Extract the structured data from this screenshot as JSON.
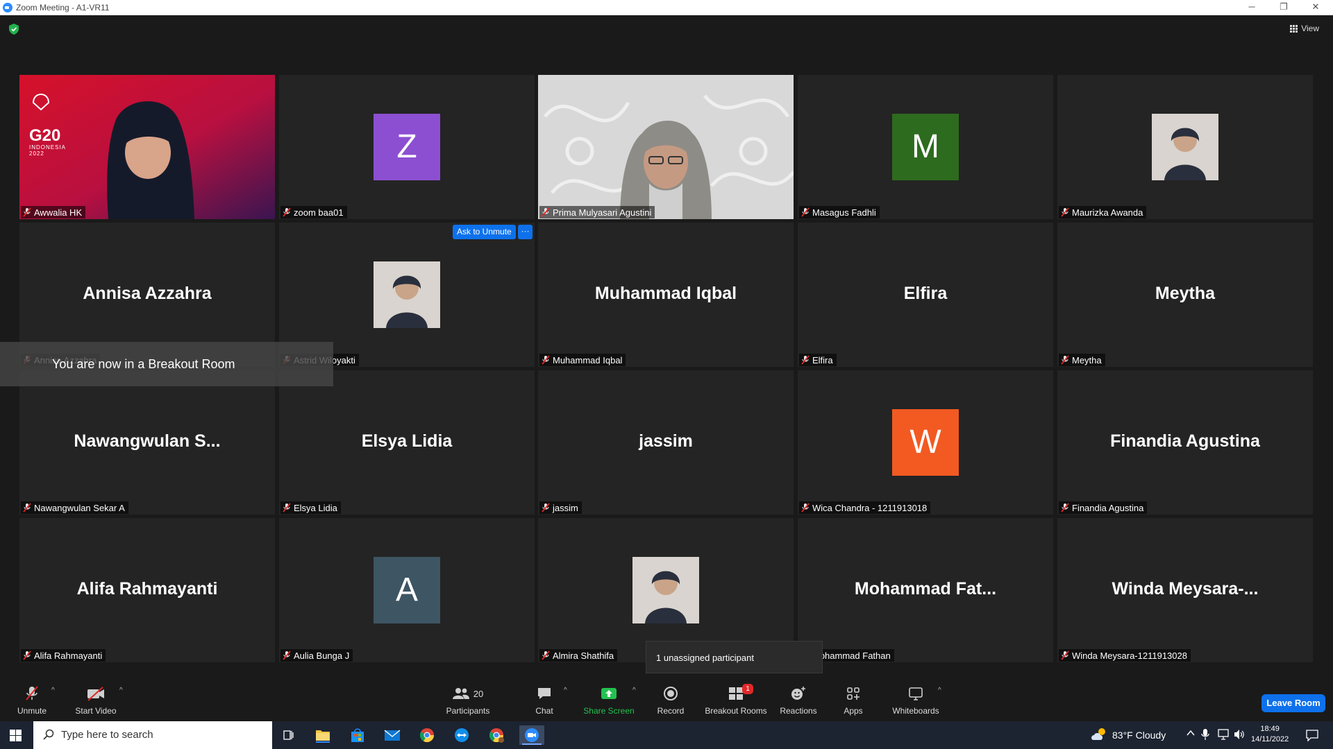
{
  "window": {
    "title": "Zoom Meeting - A1-VR11",
    "minimize": "─",
    "restore": "❐",
    "close": "✕"
  },
  "header": {
    "view_label": "View"
  },
  "tiles": [
    {
      "plate": "Awwalia HK",
      "kind": "video-g20",
      "g20_logo": "G20",
      "g20_sub": "INDONESIA",
      "g20_year": "2022"
    },
    {
      "plate": "zoom baa01",
      "kind": "letter",
      "letter": "Z",
      "color": "#8c4fd1"
    },
    {
      "plate": "Prima Mulyasari Agustini",
      "kind": "video-active"
    },
    {
      "plate": "Masagus Fadhli",
      "kind": "letter",
      "letter": "M",
      "color": "#2d6b1e"
    },
    {
      "plate": "Maurizka Awanda",
      "kind": "photo"
    },
    {
      "plate": "Annisa Azzahra",
      "big": "Annisa Azzahra",
      "kind": "name"
    },
    {
      "plate": "Astrid Wiloyakti",
      "kind": "photo"
    },
    {
      "plate": "Muhammad Iqbal",
      "big": "Muhammad Iqbal",
      "kind": "name"
    },
    {
      "plate": "Elfira",
      "big": "Elfira",
      "kind": "name"
    },
    {
      "plate": "Meytha",
      "big": "Meytha",
      "kind": "name"
    },
    {
      "plate": "Nawangwulan Sekar A",
      "big": "Nawangwulan  S...",
      "kind": "name"
    },
    {
      "plate": "Elsya Lidia",
      "big": "Elsya Lidia",
      "kind": "name"
    },
    {
      "plate": "jassim",
      "big": "jassim",
      "kind": "name"
    },
    {
      "plate": "Wica Chandra - 1211913018",
      "kind": "letter",
      "letter": "W",
      "color": "#f25a22"
    },
    {
      "plate": "Finandia Agustina",
      "big": "Finandia Agustina",
      "kind": "name"
    },
    {
      "plate": "Alifa Rahmayanti",
      "big": "Alifa Rahmayanti",
      "kind": "name"
    },
    {
      "plate": "Aulia Bunga J",
      "kind": "letter",
      "letter": "A",
      "color": "#3e5563"
    },
    {
      "plate": "Almira Shathifa",
      "kind": "photo"
    },
    {
      "plate": "Mohammad Fathan",
      "big": "Mohammad  Fat...",
      "kind": "name"
    },
    {
      "plate": "Winda Meysara-1211913028",
      "big": "Winda  Meysara-...",
      "kind": "name"
    }
  ],
  "overlays": {
    "toast": "You are now in a Breakout Room",
    "ask_unmute": "Ask to Unmute",
    "more": "···",
    "tooltip": "1 unassigned participant"
  },
  "toolbar": {
    "unmute": "Unmute",
    "start_video": "Start Video",
    "participants": "Participants",
    "participants_count": "20",
    "chat": "Chat",
    "share_screen": "Share Screen",
    "record": "Record",
    "breakout_rooms": "Breakout Rooms",
    "breakout_badge": "1",
    "reactions": "Reactions",
    "apps": "Apps",
    "whiteboards": "Whiteboards",
    "leave": "Leave Room",
    "caret": "^"
  },
  "taskbar": {
    "search_placeholder": "Type here to search",
    "weather": "83°F  Cloudy",
    "time": "18:49",
    "date": "14/11/2022"
  },
  "colors": {
    "accent": "#0e71eb",
    "active_speaker": "#c6e84a",
    "share_green": "#24c250",
    "muted_red": "#e02828"
  }
}
